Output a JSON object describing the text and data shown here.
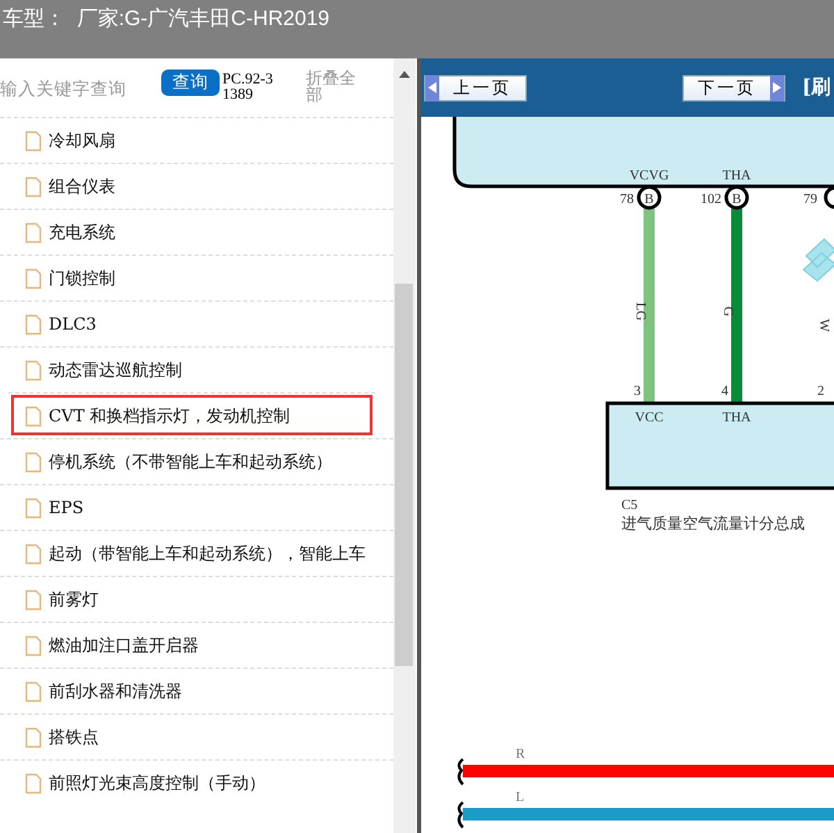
{
  "header": {
    "title": "车型：  厂家:G-广汽丰田C-HR2019"
  },
  "sidebar": {
    "search": {
      "placeholder": "输入关键字查询"
    },
    "search_button": "查询",
    "doc_code": "PC.92-31389",
    "collapse_all": "折叠全部",
    "items": [
      {
        "label": "冷却风扇",
        "selected": false
      },
      {
        "label": "组合仪表",
        "selected": false
      },
      {
        "label": "充电系统",
        "selected": false
      },
      {
        "label": "门锁控制",
        "selected": false
      },
      {
        "label": "DLC3",
        "selected": false
      },
      {
        "label": "动态雷达巡航控制",
        "selected": false
      },
      {
        "label": "CVT 和换档指示灯，发动机控制",
        "selected": true
      },
      {
        "label": "停机系统（不带智能上车和起动系统）",
        "selected": false
      },
      {
        "label": "EPS",
        "selected": false
      },
      {
        "label": "起动（带智能上车和起动系统），智能上车",
        "selected": false
      },
      {
        "label": "前雾灯",
        "selected": false
      },
      {
        "label": "燃油加注口盖开启器",
        "selected": false
      },
      {
        "label": "前刮水器和清洗器",
        "selected": false
      },
      {
        "label": "搭铁点",
        "selected": false
      },
      {
        "label": "前照灯光束高度控制（手动）",
        "selected": false
      }
    ]
  },
  "viewer": {
    "prev_button": "上一页",
    "next_button": "下一页",
    "refresh_link": "[刷",
    "diagram": {
      "pins": [
        {
          "top_name": "VCVG",
          "top_number": "78",
          "top_connector": "B",
          "wire": "LG",
          "color": "#7dc47f",
          "bottom_number": "3",
          "bottom_name": "VCC"
        },
        {
          "top_name": "THA",
          "top_number": "102",
          "top_connector": "B",
          "wire": "G",
          "color": "#0a8a3a",
          "bottom_number": "4",
          "bottom_name": "THA"
        },
        {
          "top_number": "79",
          "wire": "W",
          "color": "#a8e4ee",
          "bottom_number": "2"
        }
      ],
      "component_code": "C5",
      "component_name": "进气质量空气流量计分总成",
      "bus_lines": [
        {
          "label": "R",
          "color": "#ff0000"
        },
        {
          "label": "L",
          "color": "#1a9cc8"
        }
      ]
    }
  }
}
